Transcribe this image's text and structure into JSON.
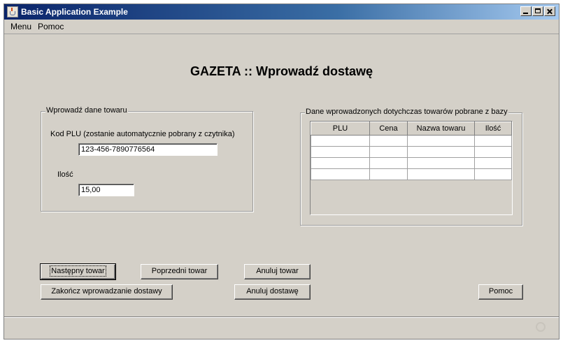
{
  "window": {
    "title": "Basic Application Example"
  },
  "menubar": {
    "items": [
      "Menu",
      "Pomoc"
    ]
  },
  "main": {
    "heading": "GAZETA :: Wprowadź dostawę"
  },
  "input_group": {
    "legend": "Wprowadź dane towaru",
    "plu_label": "Kod PLU (zostanie automatycznie pobrany z czytnika)",
    "plu_value": "123-456-7890776564",
    "qty_label": "Ilość",
    "qty_value": "15,00"
  },
  "table_group": {
    "legend": "Dane wprowadzonych dotychczas towarów pobrane z bazy",
    "columns": [
      "PLU",
      "Cena",
      "Nazwa towaru",
      "Ilość"
    ],
    "rows": [
      [
        "",
        "",
        "",
        ""
      ],
      [
        "",
        "",
        "",
        ""
      ],
      [
        "",
        "",
        "",
        ""
      ],
      [
        "",
        "",
        "",
        ""
      ]
    ]
  },
  "buttons": {
    "next": "Następny towar",
    "prev": "Poprzedni towar",
    "cancel_item": "Anuluj towar",
    "finish": "Zakończ wprowadzanie dostawy",
    "cancel_delivery": "Anuluj dostawę",
    "help": "Pomoc"
  }
}
